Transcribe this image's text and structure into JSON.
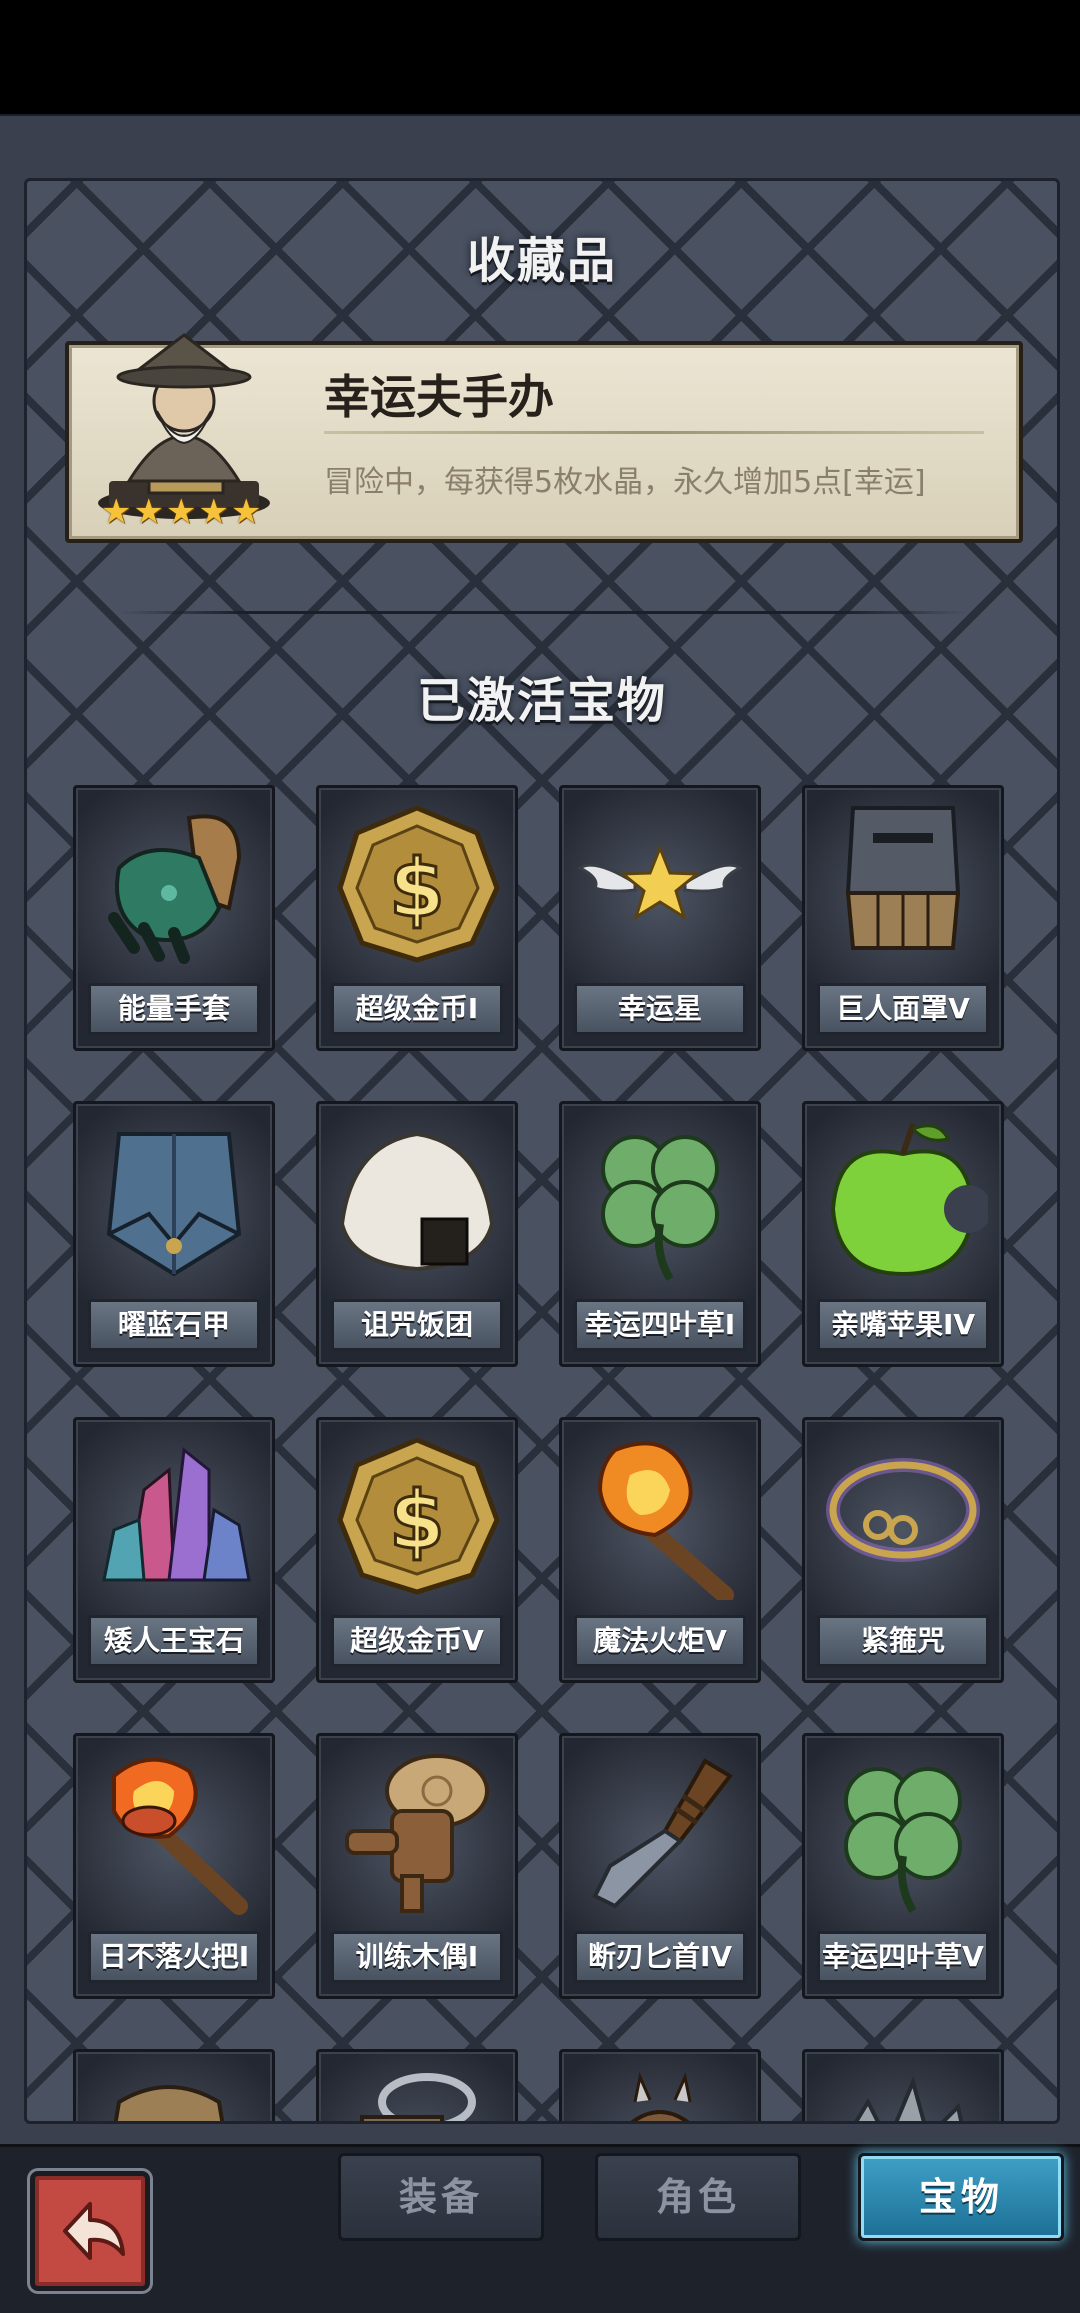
{
  "collection": {
    "title": "收藏品",
    "featured": {
      "name": "幸运夫手办",
      "description": "冒险中，每获得5枚水晶，永久增加5点[幸运]",
      "stars": 5,
      "icon": "wizard-figurine-icon"
    }
  },
  "treasures": {
    "title": "已激活宝物",
    "items": [
      {
        "label": "能量手套",
        "icon": "energy-glove-icon"
      },
      {
        "label": "超级金币I",
        "icon": "gold-coin-icon"
      },
      {
        "label": "幸运星",
        "icon": "winged-star-icon"
      },
      {
        "label": "巨人面罩V",
        "icon": "giant-mask-icon"
      },
      {
        "label": "曜蓝石甲",
        "icon": "blue-armor-icon"
      },
      {
        "label": "诅咒饭团",
        "icon": "rice-ball-icon"
      },
      {
        "label": "幸运四叶草I",
        "icon": "four-leaf-clover-icon"
      },
      {
        "label": "亲嘴苹果IV",
        "icon": "green-apple-icon"
      },
      {
        "label": "矮人王宝石",
        "icon": "crystal-gems-icon"
      },
      {
        "label": "超级金币V",
        "icon": "gold-coin-icon"
      },
      {
        "label": "魔法火炬V",
        "icon": "magic-torch-icon"
      },
      {
        "label": "紧箍咒",
        "icon": "golden-circlet-icon"
      },
      {
        "label": "日不落火把I",
        "icon": "fire-torch-icon"
      },
      {
        "label": "训练木偶I",
        "icon": "wooden-dummy-icon"
      },
      {
        "label": "断刃匕首IV",
        "icon": "broken-dagger-icon"
      },
      {
        "label": "幸运四叶草V",
        "icon": "four-leaf-clover-icon"
      }
    ]
  },
  "nav": {
    "back_icon": "return-arrow-icon",
    "tabs": [
      {
        "label": "装备",
        "active": false
      },
      {
        "label": "角色",
        "active": false
      },
      {
        "label": "宝物",
        "active": true
      }
    ]
  },
  "colors": {
    "panel": "#4a5262",
    "card": "#e6e0cc",
    "star": "#f5c23a",
    "active_tab": "#2f8fb8",
    "back_button": "#c24a42"
  }
}
